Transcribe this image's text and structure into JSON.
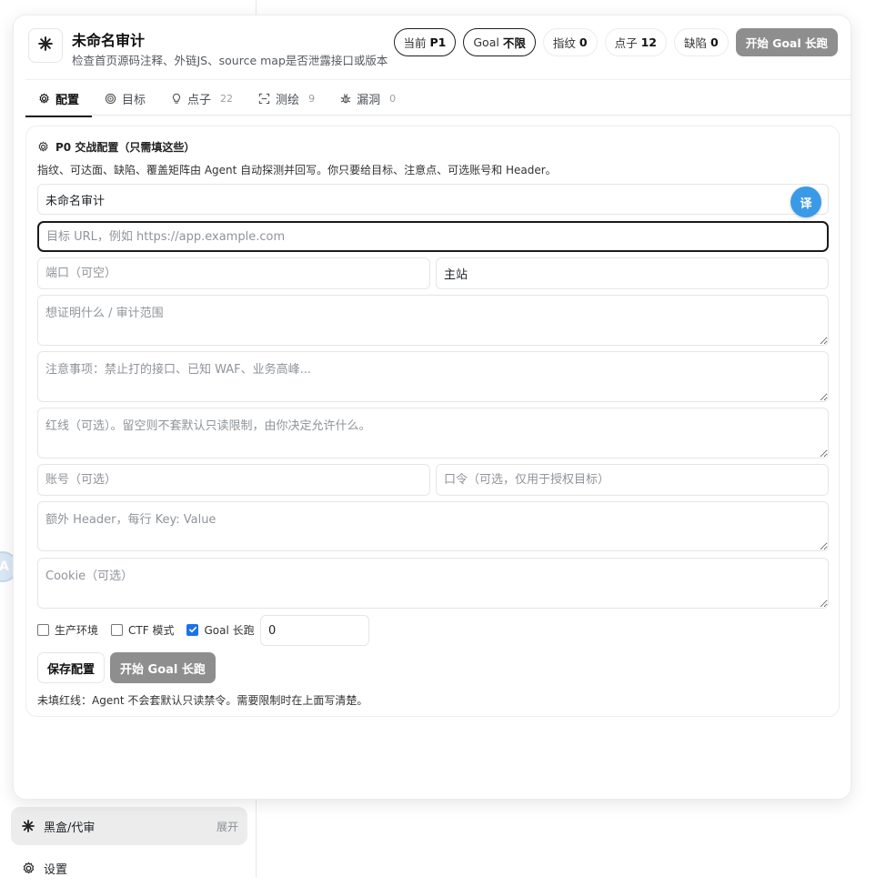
{
  "sidebar": {
    "items": [
      {
        "label": "黑盒/代审",
        "action": "展开"
      },
      {
        "label": "设置"
      }
    ],
    "avatar_letter": "A"
  },
  "header": {
    "title": "未命名审计",
    "subtitle": "检查首页源码注释、外链JS、source map是否泄露接口或版本",
    "chips": {
      "current_label": "当前",
      "current_value": "P1",
      "goal_label": "Goal",
      "goal_value": "不限",
      "fingerprint_label": "指纹",
      "fingerprint_value": "0",
      "points_label": "点子",
      "points_value": "12",
      "defects_label": "缺陷",
      "defects_value": "0"
    },
    "start_button": "开始 Goal 长跑"
  },
  "tabs": [
    {
      "label": "配置",
      "count": "",
      "icon": "gear-icon"
    },
    {
      "label": "目标",
      "count": "",
      "icon": "target-icon"
    },
    {
      "label": "点子",
      "count": "22",
      "icon": "bulb-icon"
    },
    {
      "label": "测绘",
      "count": "9",
      "icon": "scan-icon"
    },
    {
      "label": "漏洞",
      "count": "0",
      "icon": "bug-icon"
    }
  ],
  "config": {
    "title": "P0 交战配置（只需填这些）",
    "description": "指纹、可达面、缺陷、覆盖矩阵由 Agent 自动探测并回写。你只要给目标、注意点、可选账号和 Header。",
    "name_value": "未命名审计",
    "translate_label": "译",
    "url_placeholder": "目标 URL，例如 https://app.example.com",
    "port_placeholder": "端口（可空）",
    "site_value": "主站",
    "scope_placeholder": "想证明什么 / 审计范围",
    "notes_placeholder": "注意事项：禁止打的接口、已知 WAF、业务高峰...",
    "redline_placeholder": "红线（可选）。留空则不套默认只读限制，由你决定允许什么。",
    "account_placeholder": "账号（可选）",
    "password_placeholder": "口令（可选，仅用于授权目标）",
    "header_placeholder": "额外 Header，每行 Key: Value",
    "cookie_placeholder": "Cookie（可选）",
    "options": {
      "production_label": "生产环境",
      "production_checked": false,
      "ctf_label": "CTF 模式",
      "ctf_checked": false,
      "goal_label": "Goal 长跑",
      "goal_checked": true
    },
    "goal_count": "0",
    "save_button": "保存配置",
    "start_button": "开始 Goal 长跑",
    "hint": "未填红线：Agent 不会套默认只读禁令。需要限制时在上面写清楚。"
  },
  "colors": {
    "primary_disabled": "#8e8e8e",
    "accent_blue": "#3b9ae8",
    "checkbox_blue": "#1a73e8"
  }
}
